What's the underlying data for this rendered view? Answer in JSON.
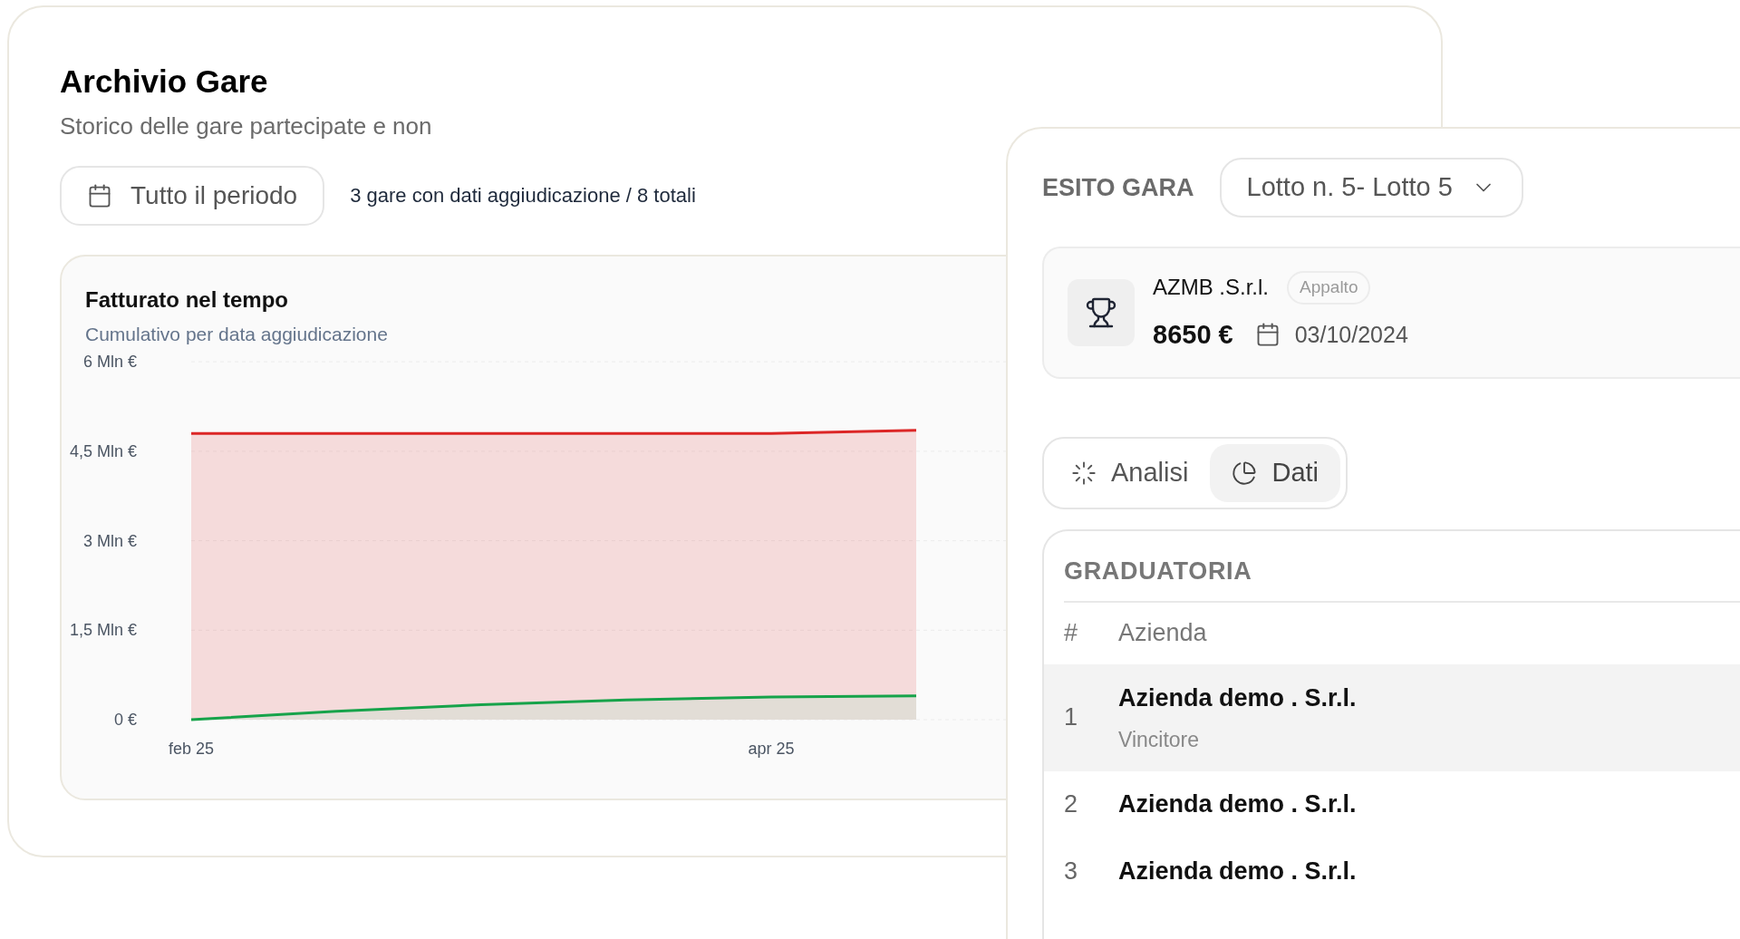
{
  "archive": {
    "title": "Archivio Gare",
    "subtitle": "Storico delle gare partecipate e non",
    "period_button": "Tutto il periodo",
    "summary": "3 gare con dati aggiudicazione / 8 totali",
    "chart": {
      "title": "Fatturato nel tempo",
      "subtitle": "Cumulativo per data aggiudicazione",
      "chart_data": {
        "type": "area",
        "categories": [
          "feb 25",
          null,
          null,
          null,
          "apr 25",
          null
        ],
        "ylim": [
          0,
          6
        ],
        "grid": true,
        "yticks": [
          {
            "value": 0,
            "label": "0 €"
          },
          {
            "value": 1.5,
            "label": "1,5 Mln €"
          },
          {
            "value": 3,
            "label": "3 Mln €"
          },
          {
            "value": 4.5,
            "label": "4,5 Mln €"
          },
          {
            "value": 6,
            "label": "6 Mln €"
          }
        ],
        "series": [
          {
            "color": "#dc2626",
            "values": [
              4.8,
              4.8,
              4.8,
              4.8,
              4.8,
              4.85
            ]
          },
          {
            "color": "#16a34a",
            "values": [
              0,
              0.14,
              0.25,
              0.33,
              0.38,
              0.4
            ]
          }
        ]
      }
    }
  },
  "result_panel": {
    "title": "ESITO GARA",
    "lot_select": "Lotto n. 5- Lotto 5",
    "winner": {
      "company": "AZMB .S.r.l.",
      "badge": "Appalto",
      "amount": "8650 €",
      "date": "03/10/2024"
    },
    "tabs": [
      {
        "kind": "analysis",
        "label": "Analisi",
        "selected": false
      },
      {
        "kind": "data",
        "label": "Dati",
        "selected": true
      }
    ],
    "ranking": {
      "title": "GRADUATORIA",
      "columns": [
        "#",
        "Azienda"
      ],
      "rows": [
        {
          "rank": "1",
          "company": "Azienda demo . S.r.l.",
          "note": "Vincitore",
          "selected": true
        },
        {
          "rank": "2",
          "company": "Azienda demo . S.r.l.",
          "selected": false
        },
        {
          "rank": "3",
          "company": "Azienda demo . S.r.l.",
          "selected": false
        }
      ]
    }
  }
}
